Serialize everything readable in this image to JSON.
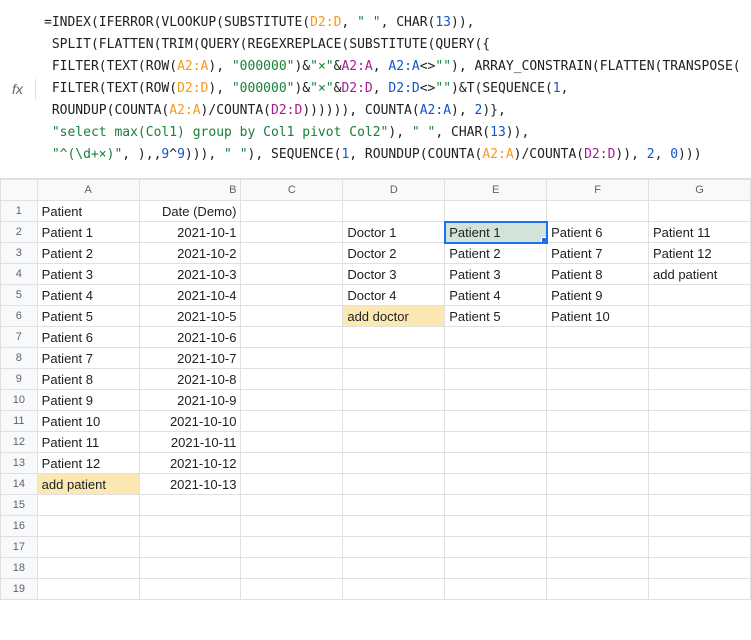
{
  "formula": {
    "lines": [
      [
        {
          "t": "=INDEX(IFERROR(VLOOKUP(SUBSTITUTE(",
          "c": ""
        },
        {
          "t": "D2:D",
          "c": "ref-orange"
        },
        {
          "t": ", ",
          "c": ""
        },
        {
          "t": "\" \"",
          "c": "str"
        },
        {
          "t": ", CHAR(",
          "c": ""
        },
        {
          "t": "13",
          "c": "num"
        },
        {
          "t": ")),",
          "c": ""
        }
      ],
      [
        {
          "t": " SPLIT(FLATTEN(TRIM(QUERY(REGEXREPLACE(SUBSTITUTE(QUERY({",
          "c": ""
        }
      ],
      [
        {
          "t": " FILTER(TEXT(ROW(",
          "c": ""
        },
        {
          "t": "A2:A",
          "c": "ref-orange"
        },
        {
          "t": "), ",
          "c": ""
        },
        {
          "t": "\"000000\"",
          "c": "str"
        },
        {
          "t": ")&",
          "c": ""
        },
        {
          "t": "\"×\"",
          "c": "str"
        },
        {
          "t": "&",
          "c": ""
        },
        {
          "t": "A2:A",
          "c": "ref-purple"
        },
        {
          "t": ", ",
          "c": ""
        },
        {
          "t": "A2:A",
          "c": "ref-blue"
        },
        {
          "t": "<>",
          "c": ""
        },
        {
          "t": "\"\"",
          "c": "str"
        },
        {
          "t": "), ARRAY_CONSTRAIN(FLATTEN(TRANSPOSE(",
          "c": ""
        }
      ],
      [
        {
          "t": " FILTER(TEXT(ROW(",
          "c": ""
        },
        {
          "t": "D2:D",
          "c": "ref-orange"
        },
        {
          "t": "), ",
          "c": ""
        },
        {
          "t": "\"000000\"",
          "c": "str"
        },
        {
          "t": ")&",
          "c": ""
        },
        {
          "t": "\"×\"",
          "c": "str"
        },
        {
          "t": "&",
          "c": ""
        },
        {
          "t": "D2:D",
          "c": "ref-purple"
        },
        {
          "t": ", ",
          "c": ""
        },
        {
          "t": "D2:D",
          "c": "ref-blue"
        },
        {
          "t": "<>",
          "c": ""
        },
        {
          "t": "\"\"",
          "c": "str"
        },
        {
          "t": ")&T(SEQUENCE(",
          "c": ""
        },
        {
          "t": "1",
          "c": "num"
        },
        {
          "t": ",",
          "c": ""
        }
      ],
      [
        {
          "t": " ROUNDUP(COUNTA(",
          "c": ""
        },
        {
          "t": "A2:A",
          "c": "ref-orange"
        },
        {
          "t": ")/COUNTA(",
          "c": ""
        },
        {
          "t": "D2:D",
          "c": "ref-purple"
        },
        {
          "t": ")))))), COUNTA(",
          "c": ""
        },
        {
          "t": "A2:A",
          "c": "ref-blue"
        },
        {
          "t": "), ",
          "c": ""
        },
        {
          "t": "2",
          "c": "num"
        },
        {
          "t": ")},",
          "c": ""
        }
      ],
      [
        {
          "t": " ",
          "c": ""
        },
        {
          "t": "\"select max(Col1) group by Col1 pivot Col2\"",
          "c": "str"
        },
        {
          "t": "), ",
          "c": ""
        },
        {
          "t": "\" \"",
          "c": "str"
        },
        {
          "t": ", CHAR(",
          "c": ""
        },
        {
          "t": "13",
          "c": "num"
        },
        {
          "t": ")),",
          "c": ""
        }
      ],
      [
        {
          "t": " ",
          "c": ""
        },
        {
          "t": "\"^(\\d+×)\"",
          "c": "str"
        },
        {
          "t": ", ),,",
          "c": ""
        },
        {
          "t": "9",
          "c": "num"
        },
        {
          "t": "^",
          "c": ""
        },
        {
          "t": "9",
          "c": "num"
        },
        {
          "t": "))), ",
          "c": ""
        },
        {
          "t": "\" \"",
          "c": "str"
        },
        {
          "t": "), SEQUENCE(",
          "c": ""
        },
        {
          "t": "1",
          "c": "num"
        },
        {
          "t": ", ROUNDUP(COUNTA(",
          "c": ""
        },
        {
          "t": "A2:A",
          "c": "ref-orange"
        },
        {
          "t": ")/COUNTA(",
          "c": ""
        },
        {
          "t": "D2:D",
          "c": "ref-purple"
        },
        {
          "t": ")), ",
          "c": ""
        },
        {
          "t": "2",
          "c": "num"
        },
        {
          "t": ", ",
          "c": ""
        },
        {
          "t": "0",
          "c": "num"
        },
        {
          "t": ")))",
          "c": ""
        }
      ]
    ]
  },
  "fx": "fx",
  "cols": [
    "A",
    "B",
    "C",
    "D",
    "E",
    "F",
    "G"
  ],
  "headers": {
    "A": "Patient",
    "B": "Date (Demo)"
  },
  "rows": [
    {
      "n": "1",
      "A": "Patient",
      "B": "Date (Demo)",
      "Abold": true,
      "Bbold": true
    },
    {
      "n": "2",
      "A": "Patient 1",
      "B": "2021-10-1",
      "D": "Doctor 1",
      "E": "Patient 1",
      "F": "Patient 6",
      "G": "Patient 11",
      "Eactive": true
    },
    {
      "n": "3",
      "A": "Patient 2",
      "B": "2021-10-2",
      "D": "Doctor 2",
      "E": "Patient 2",
      "F": "Patient 7",
      "G": "Patient 12"
    },
    {
      "n": "4",
      "A": "Patient 3",
      "B": "2021-10-3",
      "D": "Doctor 3",
      "E": "Patient 3",
      "F": "Patient 8",
      "G": "add patient"
    },
    {
      "n": "5",
      "A": "Patient 4",
      "B": "2021-10-4",
      "D": "Doctor 4",
      "E": "Patient 4",
      "F": "Patient 9"
    },
    {
      "n": "6",
      "A": "Patient 5",
      "B": "2021-10-5",
      "D": "add doctor",
      "Dhl": true,
      "E": "Patient 5",
      "F": "Patient 10"
    },
    {
      "n": "7",
      "A": "Patient 6",
      "B": "2021-10-6"
    },
    {
      "n": "8",
      "A": "Patient 7",
      "B": "2021-10-7"
    },
    {
      "n": "9",
      "A": "Patient 8",
      "B": "2021-10-8"
    },
    {
      "n": "10",
      "A": "Patient 9",
      "B": "2021-10-9"
    },
    {
      "n": "11",
      "A": "Patient 10",
      "B": "2021-10-10"
    },
    {
      "n": "12",
      "A": "Patient 11",
      "B": "2021-10-11"
    },
    {
      "n": "13",
      "A": "Patient 12",
      "B": "2021-10-12"
    },
    {
      "n": "14",
      "A": "add patient",
      "Ahl": true,
      "B": "2021-10-13"
    },
    {
      "n": "15"
    },
    {
      "n": "16"
    },
    {
      "n": "17"
    },
    {
      "n": "18"
    },
    {
      "n": "19"
    }
  ]
}
